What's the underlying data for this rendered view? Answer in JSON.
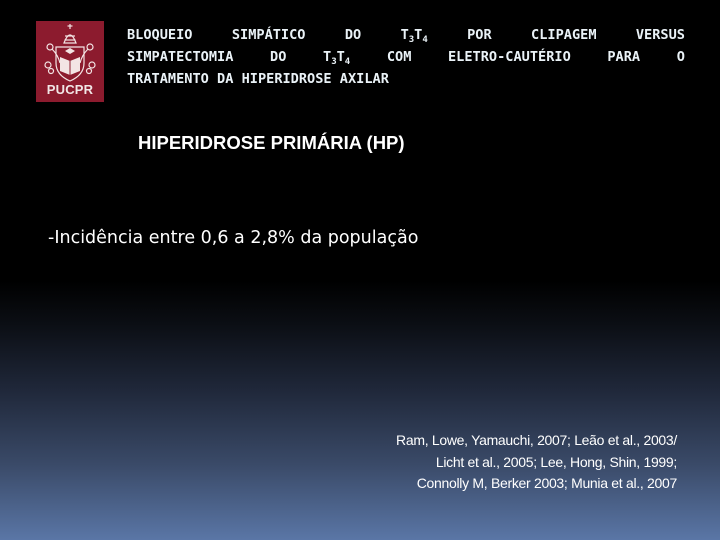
{
  "logo": {
    "text": "PUCPR",
    "background_color": "#8c1b2e"
  },
  "title": {
    "line1": [
      "BLOQUEIO",
      "SIMPÁTICO",
      "DO",
      "T3T4",
      "POR",
      "CLIPAGEM",
      "VERSUS"
    ],
    "line2": [
      "SIMPATECTOMIA",
      "DO",
      "T3T4",
      "COM",
      "ELETRO-CAUTÉRIO",
      "PARA",
      "O"
    ],
    "line3": "TRATAMENTO DA HIPERIDROSE AXILAR",
    "word_bloqueio": "BLOQUEIO",
    "word_simpatico": "SIMPÁTICO",
    "word_do": "DO",
    "word_por": "POR",
    "word_clipagem": "CLIPAGEM",
    "word_versus": "VERSUS",
    "word_simpatectomia": "SIMPATECTOMIA",
    "word_com": "COM",
    "word_eletro": "ELETRO-CAUTÉRIO",
    "word_para": "PARA",
    "word_o": "O",
    "t": "T",
    "sub3": "3",
    "sub4": "4"
  },
  "subtitle": "HIPERIDROSE PRIMÁRIA (HP)",
  "bullets": [
    "-Incidência entre 0,6 a 2,8% da população"
  ],
  "references": [
    "Ram, Lowe, Yamauchi, 2007; Leão et al., 2003/",
    "Licht et al., 2005; Lee, Hong, Shin, 1999;",
    "Connolly M, Berker 2003; Munia et al., 2007"
  ],
  "colors": {
    "title_text": "#eaf2f7",
    "gradient_bottom": "#5a76a6"
  }
}
